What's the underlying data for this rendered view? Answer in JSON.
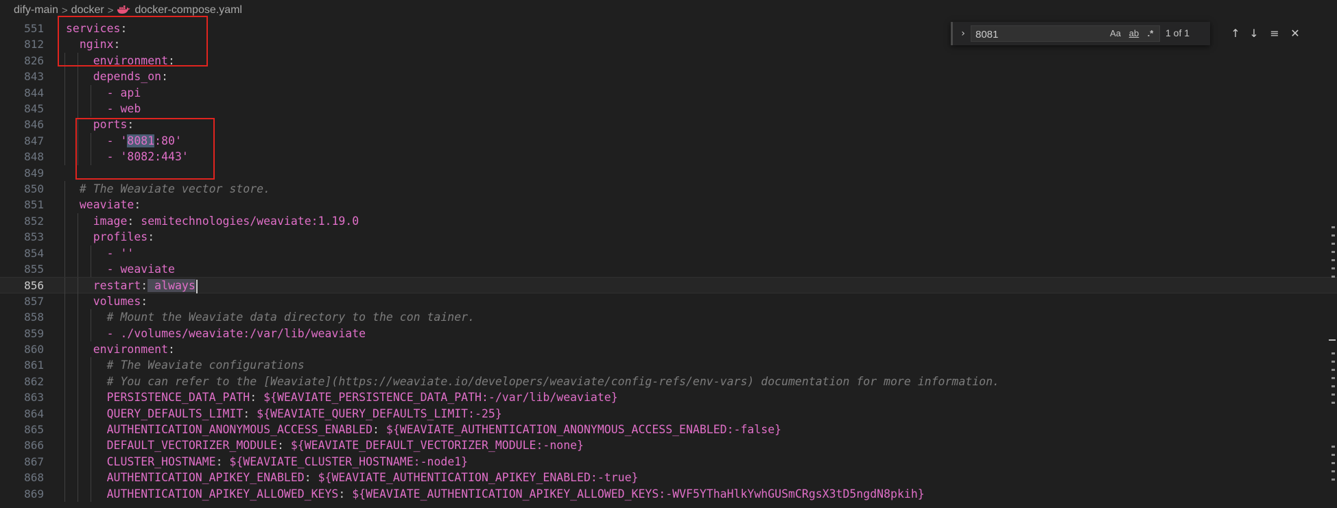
{
  "breadcrumb": {
    "segments": [
      "dify-main",
      "docker",
      "docker-compose.yaml"
    ],
    "separator": ">",
    "file_icon": "docker-whale-icon"
  },
  "find": {
    "value": "8081",
    "match_case_label": "Aa",
    "whole_word_label": "ab",
    "regex_label": ".*",
    "result": "1 of 1",
    "toggle_icon": "chevron-right-icon",
    "prev_icon": "arrow-up-icon",
    "next_icon": "arrow-down-icon",
    "selection_icon": "find-in-selection-icon",
    "close_icon": "close-icon"
  },
  "editor": {
    "active_line": "856",
    "lines": [
      {
        "n": "551",
        "indent": "",
        "key": "services",
        "rest": ""
      },
      {
        "n": "812",
        "indent": "  ",
        "key": "nginx",
        "rest": ""
      },
      {
        "n": "826",
        "indent": "    ",
        "key": "environment",
        "rest": ""
      },
      {
        "n": "843",
        "indent": "    ",
        "key": "depends_on",
        "rest": ""
      },
      {
        "n": "844",
        "indent": "      ",
        "text": "- api"
      },
      {
        "n": "845",
        "indent": "      ",
        "text": "- web"
      },
      {
        "n": "846",
        "indent": "    ",
        "key": "ports",
        "rest": ""
      },
      {
        "n": "847",
        "indent": "      ",
        "text": "- '8081:80'"
      },
      {
        "n": "848",
        "indent": "      ",
        "text": "- '8082:443'"
      },
      {
        "n": "849",
        "indent": "",
        "text": ""
      },
      {
        "n": "850",
        "indent": "  ",
        "comment": "# The Weaviate vector store."
      },
      {
        "n": "851",
        "indent": "  ",
        "key": "weaviate",
        "rest": ""
      },
      {
        "n": "852",
        "indent": "    ",
        "key": "image",
        "rest": " semitechnologies/weaviate:1.19.0"
      },
      {
        "n": "853",
        "indent": "    ",
        "key": "profiles",
        "rest": ""
      },
      {
        "n": "854",
        "indent": "      ",
        "text": "- ''"
      },
      {
        "n": "855",
        "indent": "      ",
        "text": "- weaviate"
      },
      {
        "n": "856",
        "indent": "    ",
        "key": "restart",
        "rest": " always"
      },
      {
        "n": "857",
        "indent": "    ",
        "key": "volumes",
        "rest": ""
      },
      {
        "n": "858",
        "indent": "      ",
        "comment": "# Mount the Weaviate data directory to the con tainer."
      },
      {
        "n": "859",
        "indent": "      ",
        "text": "- ./volumes/weaviate:/var/lib/weaviate"
      },
      {
        "n": "860",
        "indent": "    ",
        "key": "environment",
        "rest": ""
      },
      {
        "n": "861",
        "indent": "      ",
        "comment": "# The Weaviate configurations"
      },
      {
        "n": "862",
        "indent": "      ",
        "comment": "# You can refer to the [Weaviate](https://weaviate.io/developers/weaviate/config-refs/env-vars) documentation for more information."
      },
      {
        "n": "863",
        "indent": "      ",
        "key": "PERSISTENCE_DATA_PATH",
        "rest": " ${WEAVIATE_PERSISTENCE_DATA_PATH:-/var/lib/weaviate}"
      },
      {
        "n": "864",
        "indent": "      ",
        "key": "QUERY_DEFAULTS_LIMIT",
        "rest": " ${WEAVIATE_QUERY_DEFAULTS_LIMIT:-25}"
      },
      {
        "n": "865",
        "indent": "      ",
        "key": "AUTHENTICATION_ANONYMOUS_ACCESS_ENABLED",
        "rest": " ${WEAVIATE_AUTHENTICATION_ANONYMOUS_ACCESS_ENABLED:-false}"
      },
      {
        "n": "866",
        "indent": "      ",
        "key": "DEFAULT_VECTORIZER_MODULE",
        "rest": " ${WEAVIATE_DEFAULT_VECTORIZER_MODULE:-none}"
      },
      {
        "n": "867",
        "indent": "      ",
        "key": "CLUSTER_HOSTNAME",
        "rest": " ${WEAVIATE_CLUSTER_HOSTNAME:-node1}"
      },
      {
        "n": "868",
        "indent": "      ",
        "key": "AUTHENTICATION_APIKEY_ENABLED",
        "rest": " ${WEAVIATE_AUTHENTICATION_APIKEY_ENABLED:-true}"
      },
      {
        "n": "869",
        "indent": "      ",
        "key": "AUTHENTICATION_APIKEY_ALLOWED_KEYS",
        "rest": " ${WEAVIATE_AUTHENTICATION_APIKEY_ALLOWED_KEYS:-WVF5YThaHlkYwhGUSmCRgsX3tD5ngdN8pkih}"
      }
    ]
  },
  "colors": {
    "background": "#1f1f1f",
    "key": "#e06fc8",
    "comment": "#7c7c7c",
    "annotation_box": "#e0241f",
    "match_highlight": "#4a5d75"
  }
}
